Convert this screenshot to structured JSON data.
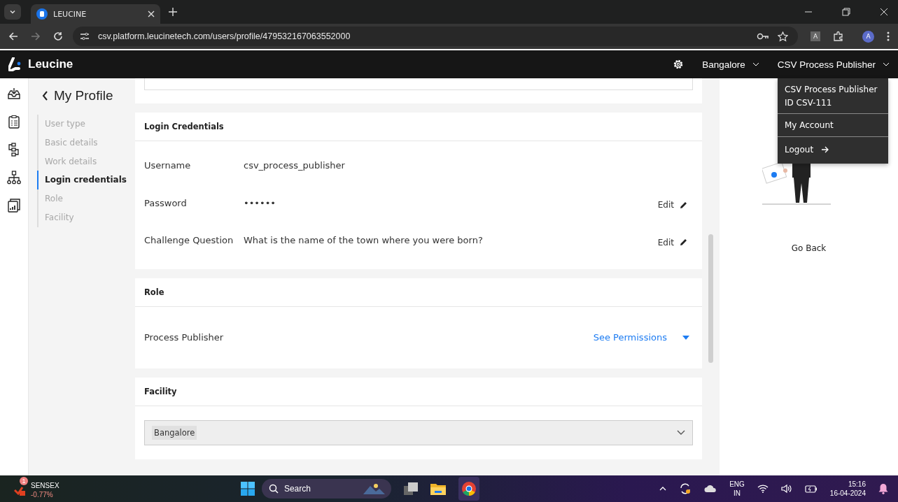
{
  "browser": {
    "tab_title": "LEUCINE",
    "url": "csv.platform.leucinetech.com/users/profile/479532167063552000",
    "profile_initial": "A",
    "extension_initial": "A"
  },
  "header": {
    "brand": "Leucine",
    "facility": "Bangalore",
    "user": "CSV Process Publisher"
  },
  "user_menu": {
    "name": "CSV Process Publisher",
    "id": "ID CSV-111",
    "items": [
      {
        "label": "My Account",
        "kind": "link"
      },
      {
        "label": "Logout",
        "kind": "logout"
      }
    ]
  },
  "profile_nav": {
    "title": "My Profile",
    "items": [
      {
        "label": "User type",
        "selected": false
      },
      {
        "label": "Basic details",
        "selected": false
      },
      {
        "label": "Work details",
        "selected": false
      },
      {
        "label": "Login credentials",
        "selected": true
      },
      {
        "label": "Role",
        "selected": false
      },
      {
        "label": "Facility",
        "selected": false
      }
    ]
  },
  "login_credentials": {
    "title": "Login Credentials",
    "rows": [
      {
        "label": "Username",
        "value": "csv_process_publisher"
      },
      {
        "label": "Password",
        "value": "••••••",
        "action": "Edit"
      },
      {
        "label": "Challenge Question",
        "value": "What is the name of the town where you were born?",
        "action": "Edit"
      }
    ]
  },
  "role": {
    "title": "Role",
    "name": "Process Publisher",
    "link": "See Permissions"
  },
  "facility": {
    "title": "Facility",
    "selected": "Bangalore"
  },
  "side_panel": {
    "link": "Go Back"
  },
  "taskbar": {
    "widget_name": "SENSEX",
    "widget_change": "-0.77%",
    "widget_badge": "1",
    "search": "Search",
    "lang_top": "ENG",
    "lang_bottom": "IN",
    "time": "15:16",
    "date": "16-04-2024"
  }
}
